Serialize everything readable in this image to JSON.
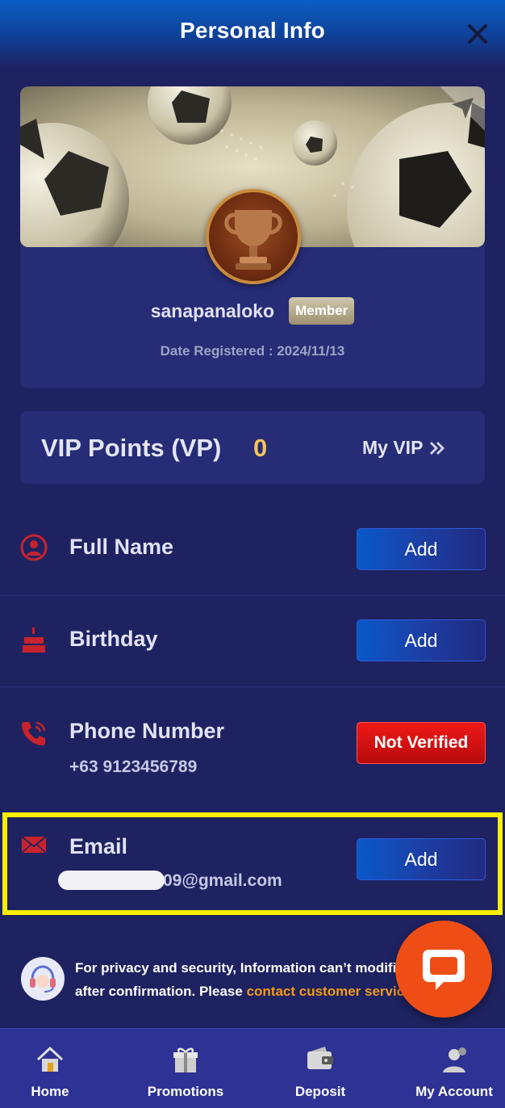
{
  "header": {
    "title": "Personal Info",
    "close_icon": "close-icon"
  },
  "profile": {
    "username": "sanapanaloko",
    "badge": "Member",
    "date_registered": "Date Registered : 2024/11/13"
  },
  "vip": {
    "label": "VIP Points (VP)",
    "value": "0",
    "link": "My VIP"
  },
  "fields": {
    "full_name": {
      "label": "Full Name",
      "action": "Add",
      "icon": "user-icon"
    },
    "birthday": {
      "label": "Birthday",
      "action": "Add",
      "icon": "cake-icon"
    },
    "phone": {
      "label": "Phone Number",
      "value": "+63 9123456789",
      "action": "Not Verified",
      "icon": "phone-icon"
    },
    "email": {
      "label": "Email",
      "value": "09@gmail.com",
      "action": "Add",
      "icon": "envelope-icon"
    }
  },
  "notice": {
    "line1": "For privacy and security, Information can’t modified",
    "line2_prefix": "after confirmation. Please ",
    "link": "contact customer service"
  },
  "nav": [
    {
      "label": "Home",
      "icon": "home-icon"
    },
    {
      "label": "Promotions",
      "icon": "gift-icon"
    },
    {
      "label": "Deposit",
      "icon": "wallet-icon"
    },
    {
      "label": "My Account",
      "icon": "account-icon"
    }
  ],
  "colors": {
    "background": "#1e2260",
    "card": "#262c75",
    "vip_value": "#f5c45a",
    "accent_red": "#c8232c",
    "highlight": "#ffee00",
    "link": "#f39a1b",
    "chat": "#ee4e16"
  }
}
